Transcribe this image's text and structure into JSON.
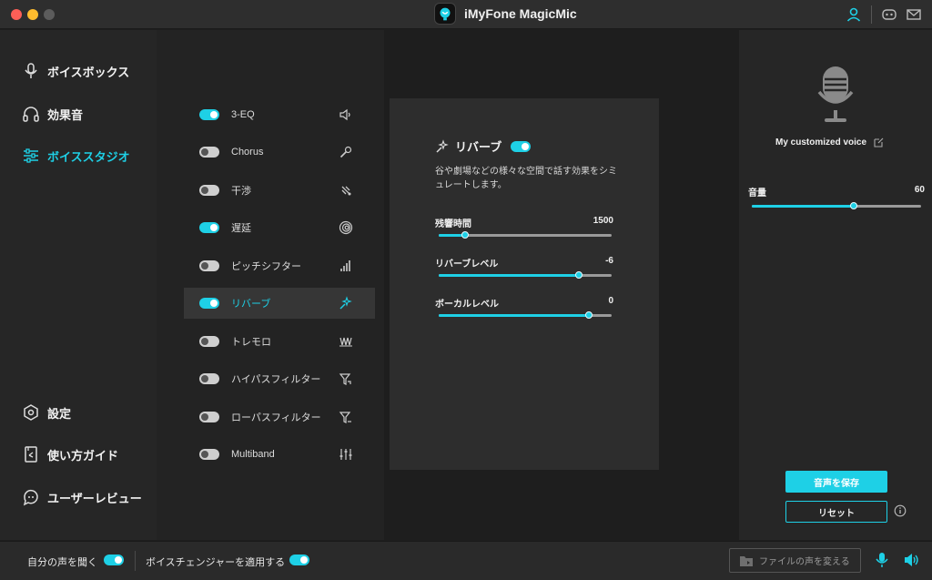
{
  "app": {
    "title": "iMyFone MagicMic"
  },
  "nav": {
    "items": [
      {
        "label": "ボイスボックス",
        "icon": "microphone-icon",
        "active": false
      },
      {
        "label": "効果音",
        "icon": "headphones-icon",
        "active": false
      },
      {
        "label": "ボイススタジオ",
        "icon": "sliders-icon",
        "active": true
      }
    ],
    "bottom_items": [
      {
        "label": "設定",
        "icon": "settings-icon"
      },
      {
        "label": "使い方ガイド",
        "icon": "guide-book-icon"
      },
      {
        "label": "ユーザーレビュー",
        "icon": "review-chat-icon"
      }
    ]
  },
  "effects": [
    {
      "label": "3-EQ",
      "enabled": true,
      "icon": "speaker-icon"
    },
    {
      "label": "Chorus",
      "enabled": false,
      "icon": "microphone-wand-icon"
    },
    {
      "label": "干渉",
      "enabled": false,
      "icon": "interference-icon"
    },
    {
      "label": "遅延",
      "enabled": true,
      "icon": "spiral-icon"
    },
    {
      "label": "ピッチシフター",
      "enabled": false,
      "icon": "bars-icon"
    },
    {
      "label": "リバーブ",
      "enabled": true,
      "icon": "magic-wand-icon",
      "selected": true
    },
    {
      "label": "トレモロ",
      "enabled": false,
      "icon": "tremolo-wave-icon"
    },
    {
      "label": "ハイパスフィルター",
      "enabled": false,
      "icon": "highpass-filter-icon"
    },
    {
      "label": "ローパスフィルター",
      "enabled": false,
      "icon": "lowpass-filter-icon"
    },
    {
      "label": "Multiband",
      "enabled": false,
      "icon": "equalizer-sliders-icon"
    }
  ],
  "detail": {
    "title": "リバーブ",
    "enabled": true,
    "description": "谷や劇場などの様々な空間で話す効果をシミュレートします。",
    "params": [
      {
        "label": "残響時間",
        "value": "1500",
        "fraction": 0.15
      },
      {
        "label": "リバーブレベル",
        "value": "-6",
        "fraction": 0.81
      },
      {
        "label": "ボーカルレベル",
        "value": "0",
        "fraction": 0.87
      }
    ]
  },
  "right": {
    "voice_name": "My customized voice",
    "volume_label": "音量",
    "volume_value": "60",
    "volume_fraction": 0.6,
    "save_label": "音声を保存",
    "reset_label": "リセット"
  },
  "bottom": {
    "listen_label": "自分の声を聞く",
    "listen_enabled": true,
    "apply_label": "ボイスチェンジャーを適用する",
    "apply_enabled": true,
    "file_button_label": "ファイルの声を変える"
  },
  "colors": {
    "accent": "#1ed0e6",
    "background": "#1e1e1e",
    "panel": "#2d2d2d"
  }
}
